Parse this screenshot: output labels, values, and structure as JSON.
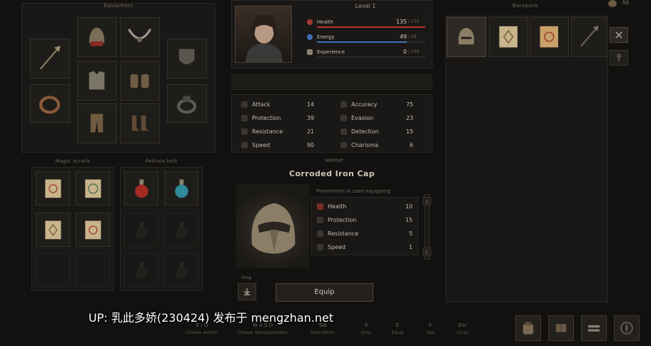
{
  "currency": {
    "amount": "50"
  },
  "sections": {
    "equipment": "Equipment",
    "magic_scrolls": "Magic scrolls",
    "potions_belt": "Potions belt",
    "backpack": "Backpack",
    "drop": "Drop"
  },
  "hero": {
    "level": "Level 1",
    "health": {
      "label": "Health",
      "value": "135",
      "max": "/ 135",
      "fill": 1.0,
      "color": "#b0342c"
    },
    "energy": {
      "label": "Energy",
      "value": "49",
      "max": "/ 59",
      "fill": 0.83,
      "color": "#3e6fb6"
    },
    "experience": {
      "label": "Experience",
      "value": "0",
      "max": "/ 100",
      "fill": 0.0,
      "color": "#8a7f70"
    }
  },
  "stats_left": [
    {
      "label": "Attack",
      "value": "14"
    },
    {
      "label": "Protection",
      "value": "39"
    },
    {
      "label": "Resistance",
      "value": "21"
    },
    {
      "label": "Speed",
      "value": "90"
    }
  ],
  "stats_right": [
    {
      "label": "Accuracy",
      "value": "75"
    },
    {
      "label": "Evasion",
      "value": "23"
    },
    {
      "label": "Detection",
      "value": "15"
    },
    {
      "label": "Charisma",
      "value": "6"
    }
  ],
  "item": {
    "category": "Helmet",
    "name": "Corroded Iron Cap",
    "params_title": "Parameters in case equipping",
    "params": [
      {
        "label": "Health",
        "value": "10"
      },
      {
        "label": "Protection",
        "value": "15"
      },
      {
        "label": "Resistance",
        "value": "5"
      },
      {
        "label": "Speed",
        "value": "1"
      }
    ],
    "scroll_up": "Z",
    "scroll_down": "C"
  },
  "actions": {
    "equip": "Equip"
  },
  "hotkeys": [
    {
      "key": "E / Q",
      "label": "Choose section"
    },
    {
      "key": "W A S D",
      "label": "Choose item/parameter"
    },
    {
      "key": "Tab",
      "label": "Description"
    },
    {
      "key": "X",
      "label": "Drop"
    },
    {
      "key": "E",
      "label": "Equip"
    },
    {
      "key": "F",
      "label": "Use"
    },
    {
      "key": "Esc",
      "label": "Close"
    }
  ],
  "watermark": "UP: 乳此多娇(230424) 发布于 mengzhan.net",
  "colors": {
    "accent": "#b0342c",
    "panel": "#1a1816",
    "border": "#2a2724",
    "text": "#c4bcae"
  }
}
